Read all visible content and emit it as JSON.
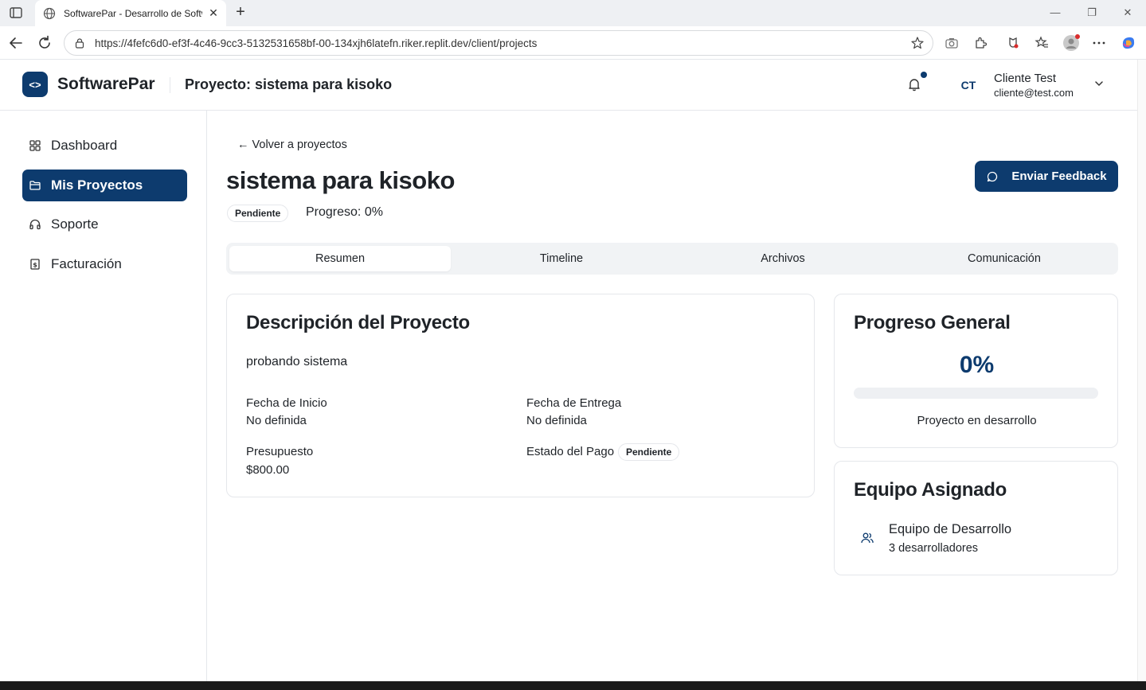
{
  "browser": {
    "tab_title": "SoftwarePar - Desarrollo de Software",
    "url": "https://4fefc6d0-ef3f-4c46-9cc3-5132531658bf-00-134xjh6latefn.riker.replit.dev/client/projects"
  },
  "header": {
    "logo_text": "<>",
    "brand": "SoftwarePar",
    "title": "Proyecto: sistema para kisoko",
    "avatar_initials": "CT",
    "user_name": "Cliente Test",
    "user_email": "cliente@test.com"
  },
  "sidebar": {
    "items": [
      {
        "label": "Dashboard",
        "icon": "dashboard-icon"
      },
      {
        "label": "Mis Proyectos",
        "icon": "folder-icon"
      },
      {
        "label": "Soporte",
        "icon": "headphones-icon"
      },
      {
        "label": "Facturación",
        "icon": "receipt-icon"
      }
    ]
  },
  "project": {
    "back_label": "← Volver a proyectos",
    "title": "sistema para kisoko",
    "status": "Pendiente",
    "progress_label": "Progreso: 0%",
    "feedback_button": "Enviar Feedback"
  },
  "tabs": [
    "Resumen",
    "Timeline",
    "Archivos",
    "Comunicación"
  ],
  "description_card": {
    "title": "Descripción del Proyecto",
    "description": "probando sistema",
    "start_label": "Fecha de Inicio",
    "start_value": "No definida",
    "delivery_label": "Fecha de Entrega",
    "delivery_value": "No definida",
    "budget_label": "Presupuesto",
    "budget_value": "$800.00",
    "payment_label": "Estado del Pago",
    "payment_value": "Pendiente"
  },
  "progress_card": {
    "title": "Progreso General",
    "percent_text": "0%",
    "progress": 0,
    "note": "Proyecto en desarrollo"
  },
  "team_card": {
    "title": "Equipo Asignado",
    "team_name": "Equipo de Desarrollo",
    "team_count": "3 desarrolladores"
  },
  "colors": {
    "primary": "#0d3b6e",
    "border": "#e5e7eb",
    "tab_bg": "#f1f3f5"
  }
}
